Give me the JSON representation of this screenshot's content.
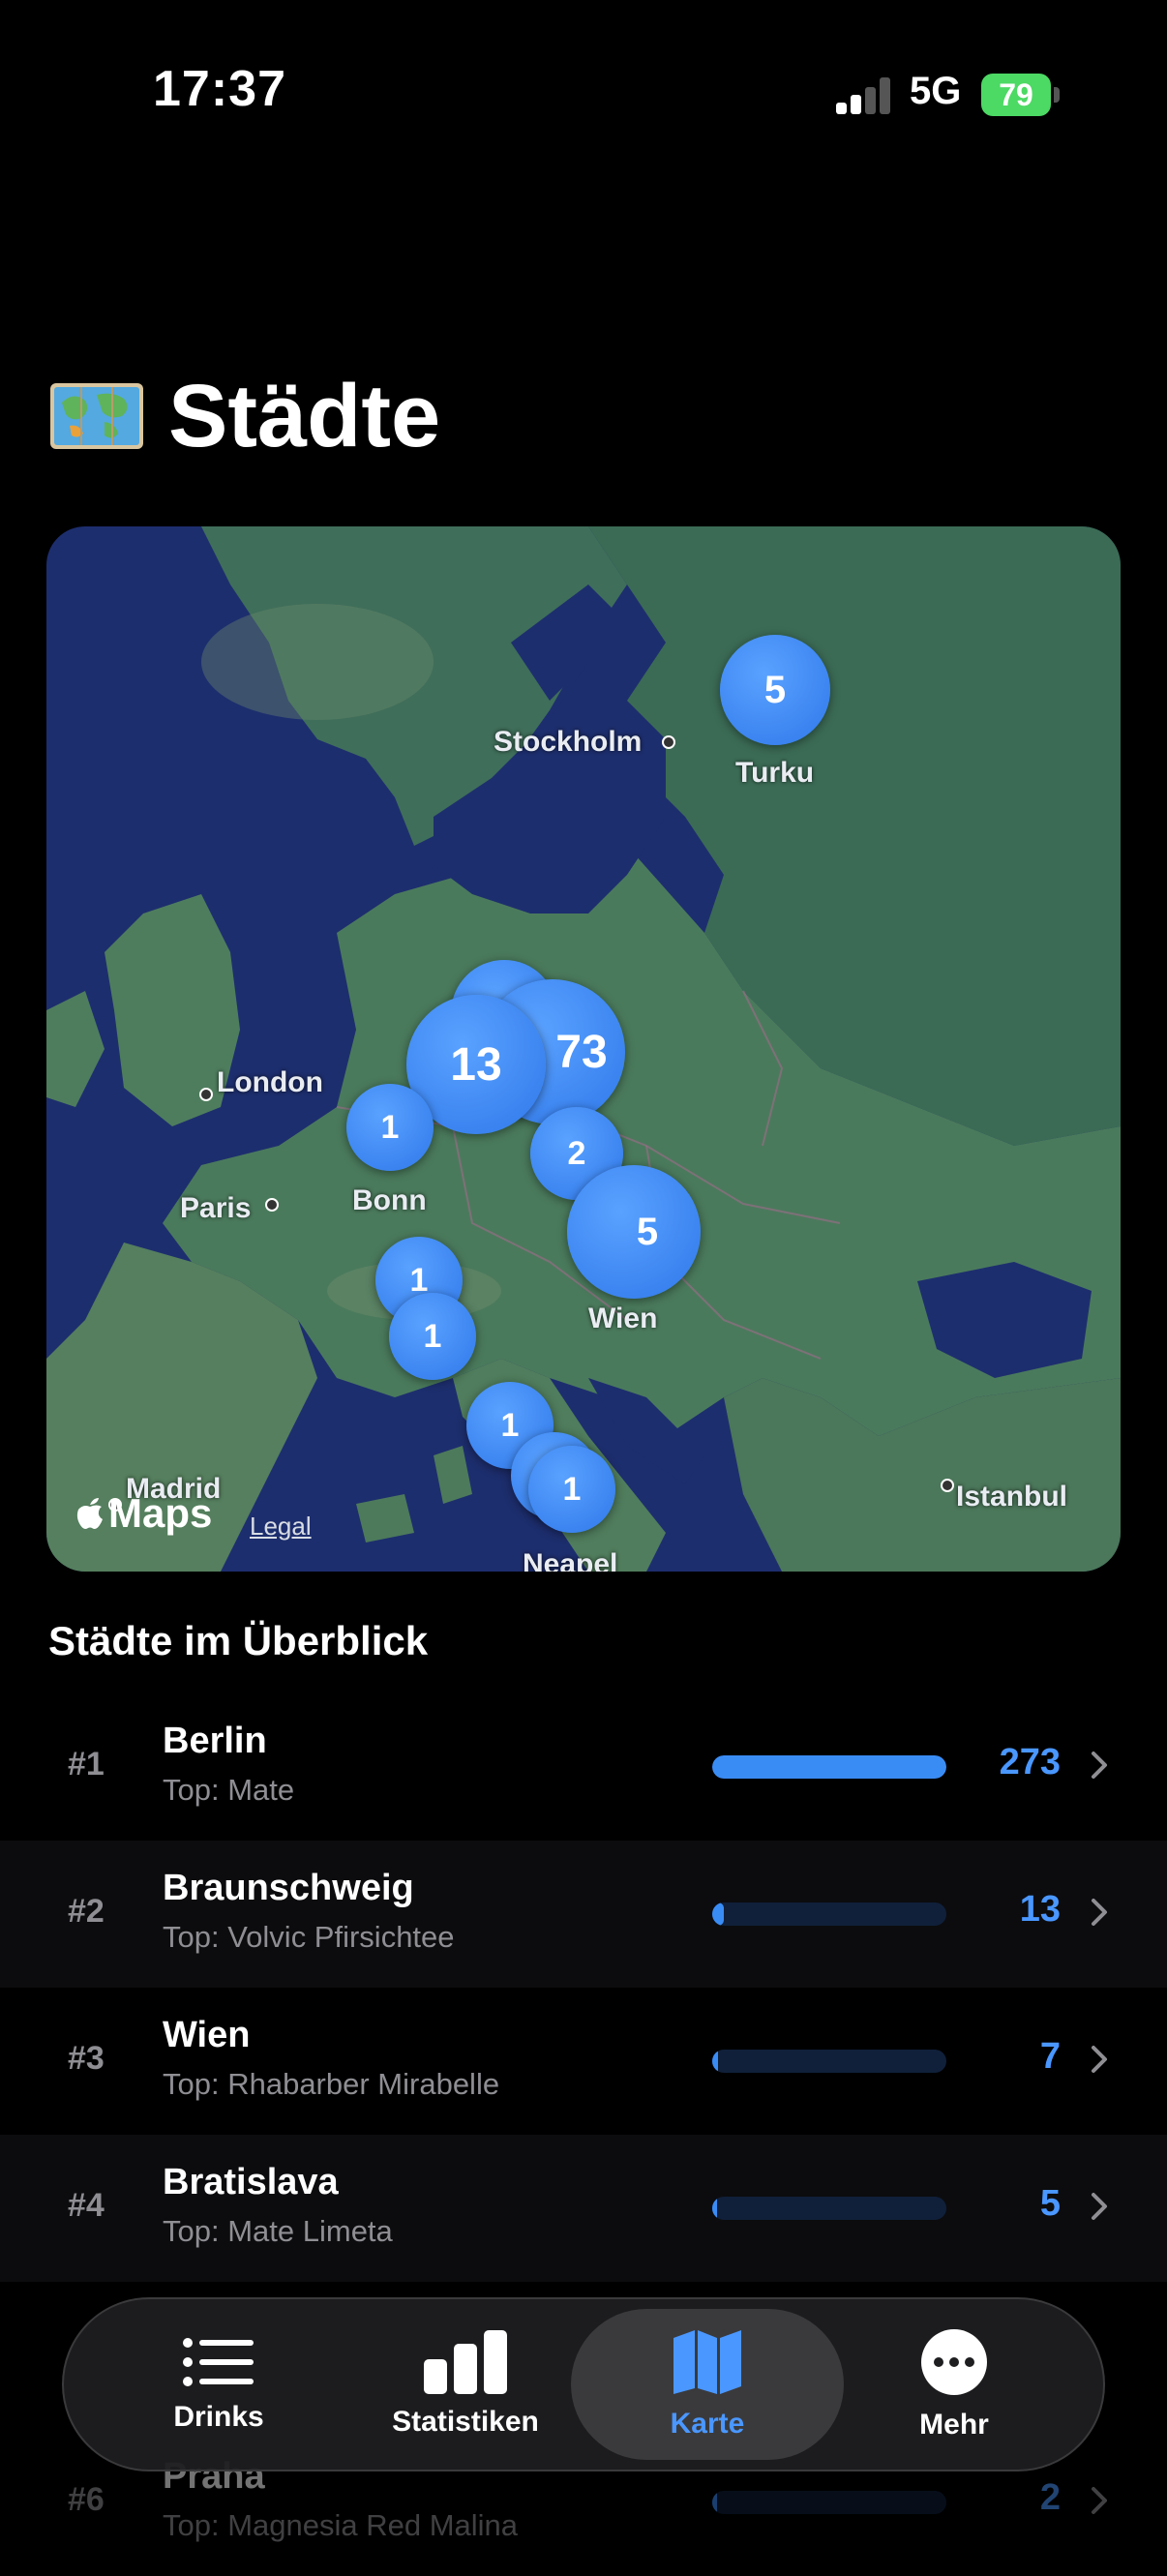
{
  "status_bar": {
    "time": "17:37",
    "network": "5G",
    "battery": "79"
  },
  "header": {
    "icon": "world-map-emoji",
    "title": "Städte"
  },
  "map": {
    "labels": {
      "stockholm": "Stockholm",
      "turku": "Turku",
      "london": "London",
      "paris": "Paris",
      "bonn": "Bonn",
      "wien": "Wien",
      "madrid": "Madrid",
      "istanbul": "Istanbul",
      "neapel": "Neapel"
    },
    "clusters": {
      "turku": "5",
      "braunschweig": "13",
      "berlin": "73",
      "bonn": "1",
      "czech": "2",
      "vienna": "5",
      "swiss": "1",
      "north_italy": "1",
      "rome": "1",
      "south_italy": "1"
    },
    "attribution": {
      "logo": "Maps",
      "legal": "Legal"
    }
  },
  "section": {
    "title": "Städte im Überblick"
  },
  "cities": [
    {
      "rank": "#1",
      "name": "Berlin",
      "top": "Top: Mate",
      "count": "273",
      "fraction": 1.0
    },
    {
      "rank": "#2",
      "name": "Braunschweig",
      "top": "Top: Volvic Pfirsichtee",
      "count": "13",
      "fraction": 0.048
    },
    {
      "rank": "#3",
      "name": "Wien",
      "top": "Top: Rhabarber Mirabelle",
      "count": "7",
      "fraction": 0.026
    },
    {
      "rank": "#4",
      "name": "Bratislava",
      "top": "Top: Mate Limeta",
      "count": "5",
      "fraction": 0.018
    },
    {
      "rank": "#6",
      "name": "Praha",
      "top": "Top: Magnesia Red Malina",
      "count": "2",
      "fraction": 0.007
    }
  ],
  "tabs": [
    {
      "label": "Drinks",
      "icon": "list-icon"
    },
    {
      "label": "Statistiken",
      "icon": "bar-chart-icon"
    },
    {
      "label": "Karte",
      "icon": "map-icon",
      "active": true
    },
    {
      "label": "Mehr",
      "icon": "more-icon"
    }
  ],
  "colors": {
    "accent": "#3a8cf5",
    "background": "#000000",
    "battery": "#4cd964"
  }
}
